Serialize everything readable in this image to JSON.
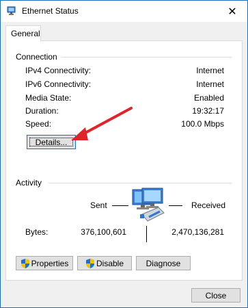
{
  "window": {
    "title": "Ethernet Status",
    "close_glyph": "✕"
  },
  "tabs": [
    {
      "label": "General"
    }
  ],
  "connection": {
    "label": "Connection",
    "rows": [
      {
        "label": "IPv4 Connectivity:",
        "value": "Internet"
      },
      {
        "label": "IPv6 Connectivity:",
        "value": "Internet"
      },
      {
        "label": "Media State:",
        "value": "Enabled"
      },
      {
        "label": "Duration:",
        "value": "19:32:17"
      },
      {
        "label": "Speed:",
        "value": "100.0 Mbps"
      }
    ],
    "details_button": "Details..."
  },
  "activity": {
    "label": "Activity",
    "sent_label": "Sent",
    "received_label": "Received",
    "bytes_label": "Bytes:",
    "bytes_sent": "376,100,601",
    "bytes_received": "2,470,136,281",
    "icon": "network-computer-icon"
  },
  "actions": {
    "properties": "Properties",
    "disable": "Disable",
    "diagnose": "Diagnose"
  },
  "footer": {
    "close": "Close"
  },
  "colors": {
    "accent": "#0078d7",
    "arrow": "#e0242b",
    "border": "#1c6fbf"
  }
}
